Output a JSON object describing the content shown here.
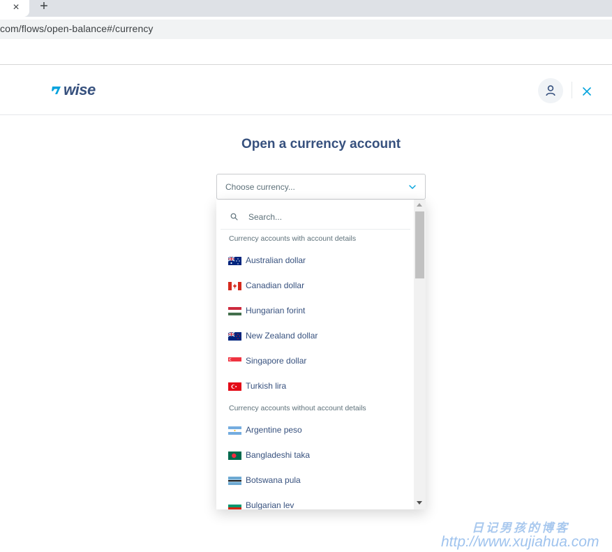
{
  "browser": {
    "close_glyph": "×",
    "new_tab_glyph": "+",
    "url": "com/flows/open-balance#/currency"
  },
  "header": {
    "logo_text": "wise",
    "brand_color": "#37517e",
    "accent_color": "#00a2dd",
    "icons": [
      "wise-logo-icon",
      "user-icon",
      "close-icon"
    ]
  },
  "main": {
    "title": "Open a currency account",
    "select": {
      "placeholder": "Choose currency..."
    }
  },
  "dropdown": {
    "search_placeholder": "Search...",
    "groups": [
      {
        "label": "Currency accounts with account details",
        "options": [
          {
            "label": "Australian dollar",
            "flag": "australia-flag-icon"
          },
          {
            "label": "Canadian dollar",
            "flag": "canada-flag-icon"
          },
          {
            "label": "Hungarian forint",
            "flag": "hungary-flag-icon"
          },
          {
            "label": "New Zealand dollar",
            "flag": "new-zealand-flag-icon"
          },
          {
            "label": "Singapore dollar",
            "flag": "singapore-flag-icon"
          },
          {
            "label": "Turkish lira",
            "flag": "turkey-flag-icon"
          }
        ]
      },
      {
        "label": "Currency accounts without account details",
        "options": [
          {
            "label": "Argentine peso",
            "flag": "argentina-flag-icon"
          },
          {
            "label": "Bangladeshi taka",
            "flag": "bangladesh-flag-icon"
          },
          {
            "label": "Botswana pula",
            "flag": "botswana-flag-icon"
          },
          {
            "label": "Bulgarian lev",
            "flag": "bulgaria-flag-icon"
          }
        ]
      }
    ]
  },
  "watermark": {
    "line1": "日记男孩的博客",
    "line2": "http://www.xujiahua.com"
  }
}
